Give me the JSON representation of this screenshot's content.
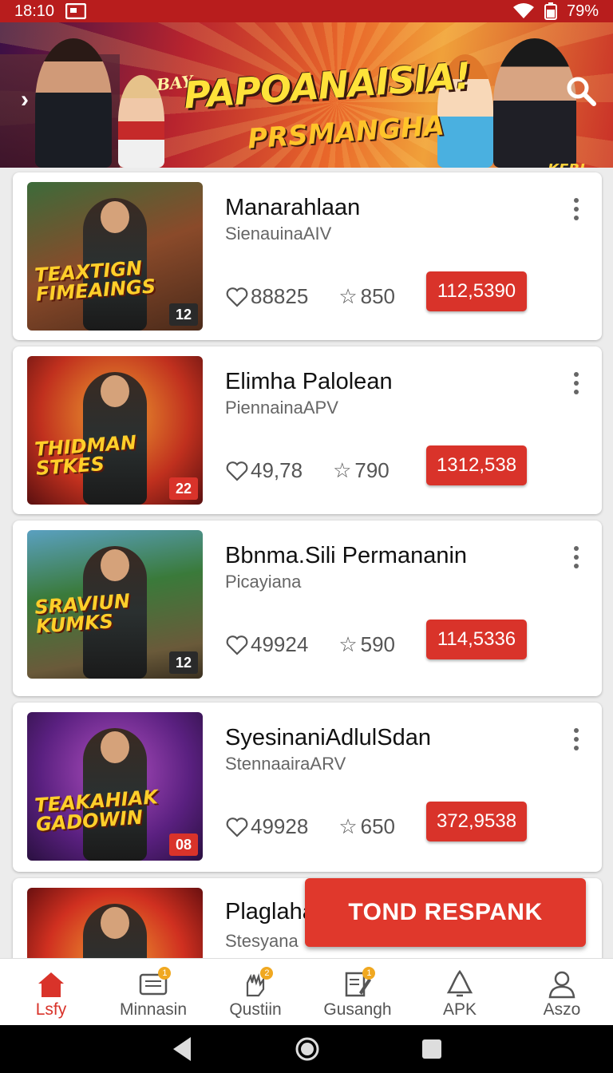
{
  "status_bar": {
    "time": "18:10",
    "battery": "79%"
  },
  "banner": {
    "small": "BAY",
    "title": "PAPOANAISIA!",
    "subtitle": "PRSMANGHA",
    "corner": "KEBL"
  },
  "games": [
    {
      "name": "Manarahlaan",
      "subtitle": "SienauinaAIV",
      "thumb_title": "TEAXTIGN FIMEAINGS",
      "badge": "12",
      "likes": "88825",
      "rating": "850",
      "price": "112,5390"
    },
    {
      "name": "Elimha Palolean",
      "subtitle": "PiennainaAPV",
      "thumb_title": "THIDMAN STKES",
      "badge": "22",
      "likes": "49,78",
      "rating": "790",
      "price": "1312,538"
    },
    {
      "name": "Bbnma.Sili Permananin",
      "subtitle": "Picayiana",
      "thumb_title": "SRAVIUN KUMKS",
      "badge": "12",
      "likes": "49924",
      "rating": "590",
      "price": "114,5336"
    },
    {
      "name": "SyesinaniAdlulSdan",
      "subtitle": "StennaairaARV",
      "thumb_title": "TEAKAHIAK GADOWIN",
      "badge": "08",
      "likes": "49928",
      "rating": "650",
      "price": "372,9538"
    },
    {
      "name": "Plaglaha",
      "subtitle": "Stesyana",
      "thumb_title": "",
      "badge": "",
      "likes": "",
      "rating": "",
      "price": ""
    }
  ],
  "cta_button": "TOND RESPANK",
  "tabs": [
    {
      "label": "Lsfy",
      "icon": "home-icon",
      "badge": ""
    },
    {
      "label": "Minnasin",
      "icon": "messages-icon",
      "badge": "1"
    },
    {
      "label": "Qustiin",
      "icon": "hand-icon",
      "badge": "2"
    },
    {
      "label": "Gusangh",
      "icon": "edit-icon",
      "badge": "1"
    },
    {
      "label": "APK",
      "icon": "apk-icon",
      "badge": ""
    },
    {
      "label": "Aszo",
      "icon": "profile-icon",
      "badge": ""
    }
  ],
  "colors": {
    "accent": "#d9332a",
    "status_bar": "#b81d1d"
  }
}
